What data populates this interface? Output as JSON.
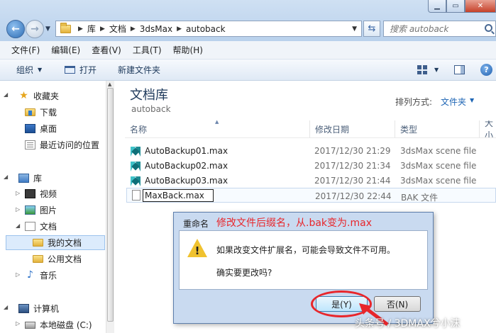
{
  "address": {
    "crumbs": [
      "库",
      "文档",
      "3dsMax",
      "autoback"
    ]
  },
  "search": {
    "placeholder": "搜索 autoback"
  },
  "menu": [
    "文件(F)",
    "编辑(E)",
    "查看(V)",
    "工具(T)",
    "帮助(H)"
  ],
  "commands": {
    "organize": "组织",
    "open": "打开",
    "new_folder": "新建文件夹"
  },
  "nav": {
    "favorites": "收藏夹",
    "downloads": "下载",
    "desktop": "桌面",
    "recent": "最近访问的位置",
    "libraries": "库",
    "videos": "视频",
    "pictures": "图片",
    "documents": "文档",
    "my_documents": "我的文档",
    "public_documents": "公用文档",
    "music": "音乐",
    "computer": "计算机",
    "local_disk": "本地磁盘 (C:)"
  },
  "library": {
    "title": "文档库",
    "subtitle": "autoback",
    "arrange_label": "排列方式:",
    "arrange_value": "文件夹"
  },
  "columns": {
    "name": "名称",
    "date": "修改日期",
    "type": "类型",
    "size": "大小"
  },
  "files": [
    {
      "name": "AutoBackup01.max",
      "date": "2017/12/30 21:29",
      "type": "3dsMax scene file"
    },
    {
      "name": "AutoBackup02.max",
      "date": "2017/12/30 21:34",
      "type": "3dsMax scene file"
    },
    {
      "name": "AutoBackup03.max",
      "date": "2017/12/30 21:44",
      "type": "3dsMax scene file"
    }
  ],
  "editing_file": {
    "name": "MaxBack.max",
    "date": "2017/12/30 22:44",
    "type": "BAK 文件"
  },
  "dialog": {
    "title": "重命名",
    "annotation": "修改文件后缀名，从.bak变为.max",
    "message": "如果改变文件扩展名，可能会导致文件不可用。",
    "question": "确实要更改吗?",
    "yes": "是(Y)",
    "no": "否(N)"
  },
  "watermark": "头条号 / 3DMAX兮小沫",
  "colors": {
    "accent": "#1c64b4",
    "annotation_red": "#e8262b"
  }
}
